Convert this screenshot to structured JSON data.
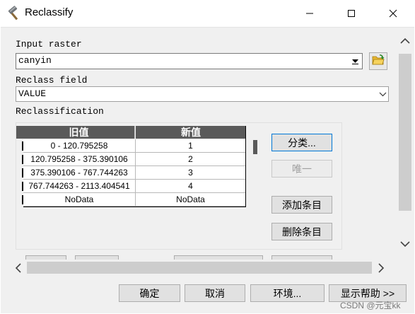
{
  "window": {
    "title": "Reclassify",
    "icon": "hammer-icon"
  },
  "form": {
    "input_raster_label": "Input raster",
    "input_raster_value": "canyin",
    "reclass_field_label": "Reclass field",
    "reclass_field_value": "VALUE",
    "reclassification_label": "Reclassification"
  },
  "table": {
    "headers": [
      "旧值",
      "新值"
    ],
    "rows": [
      {
        "old": "0 - 120.795258",
        "new": "1"
      },
      {
        "old": "120.795258 - 375.390106",
        "new": "2"
      },
      {
        "old": "375.390106 - 767.744263",
        "new": "3"
      },
      {
        "old": "767.744263 - 2113.404541",
        "new": "4"
      },
      {
        "old": "NoData",
        "new": "NoData"
      }
    ]
  },
  "side_buttons": {
    "classify": "分类...",
    "unique": "唯一",
    "add_entry": "添加条目",
    "delete_entry": "删除条目"
  },
  "footer": {
    "ok": "确定",
    "cancel": "取消",
    "environments": "环境...",
    "show_help": "显示帮助 >>"
  },
  "watermark": "CSDN @元宝kk"
}
